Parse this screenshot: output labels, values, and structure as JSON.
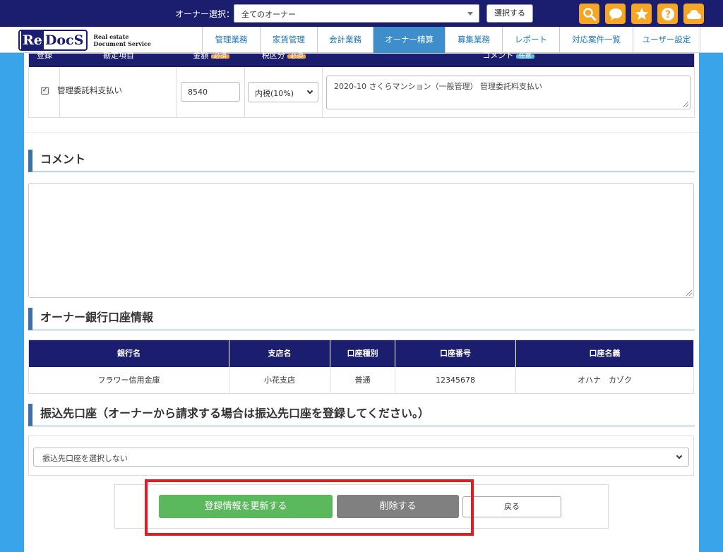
{
  "topbar": {
    "owner_label": "オーナー選択：",
    "owner_select_value": "全てのオーナー",
    "select_button": "選択する",
    "icons": [
      "search-icon",
      "chat-icon",
      "star-icon",
      "help-icon",
      "cloud-icon"
    ],
    "accent_color": "#f5a623",
    "bg_color": "#1b1d6e"
  },
  "logo": {
    "re": "Re",
    "docs": "DocS",
    "sub_line1": "Real estate",
    "sub_line2": "Document Service"
  },
  "nav": {
    "items": [
      {
        "label": "管理業務"
      },
      {
        "label": "家賃管理"
      },
      {
        "label": "会計業務"
      },
      {
        "label": "オーナー精算"
      },
      {
        "label": "募集業務"
      },
      {
        "label": "レポート"
      },
      {
        "label": "対応案件一覧"
      },
      {
        "label": "ユーザー設定"
      }
    ],
    "active": "オーナー精算"
  },
  "item_table": {
    "headers": [
      "登録",
      "勘定項目",
      "金額",
      "税区分",
      "コメント"
    ],
    "badges": {
      "amount": "必須",
      "tax": "必須",
      "comment": "任意"
    },
    "row": {
      "checked": true,
      "item": "管理委託料支払い",
      "amount": "8540",
      "tax": "内税(10%)",
      "comment": "2020-10 さくらマンション（一般管理） 管理委託料支払い"
    }
  },
  "comment_section": {
    "title": "コメント",
    "value": ""
  },
  "bank_section": {
    "title": "オーナー銀行口座情報",
    "headers": [
      "銀行名",
      "支店名",
      "口座種別",
      "口座番号",
      "口座名義"
    ],
    "row": [
      "フラワー信用金庫",
      "小花支店",
      "普通",
      "12345678",
      "オハナ　カゾク"
    ]
  },
  "transfer_section": {
    "title": "振込先口座（オーナーから請求する場合は振込先口座を登録してください。）",
    "select_value": "振込先口座を選択しない"
  },
  "actions": {
    "update": "登録情報を更新する",
    "delete": "削除する",
    "back": "戻る"
  }
}
